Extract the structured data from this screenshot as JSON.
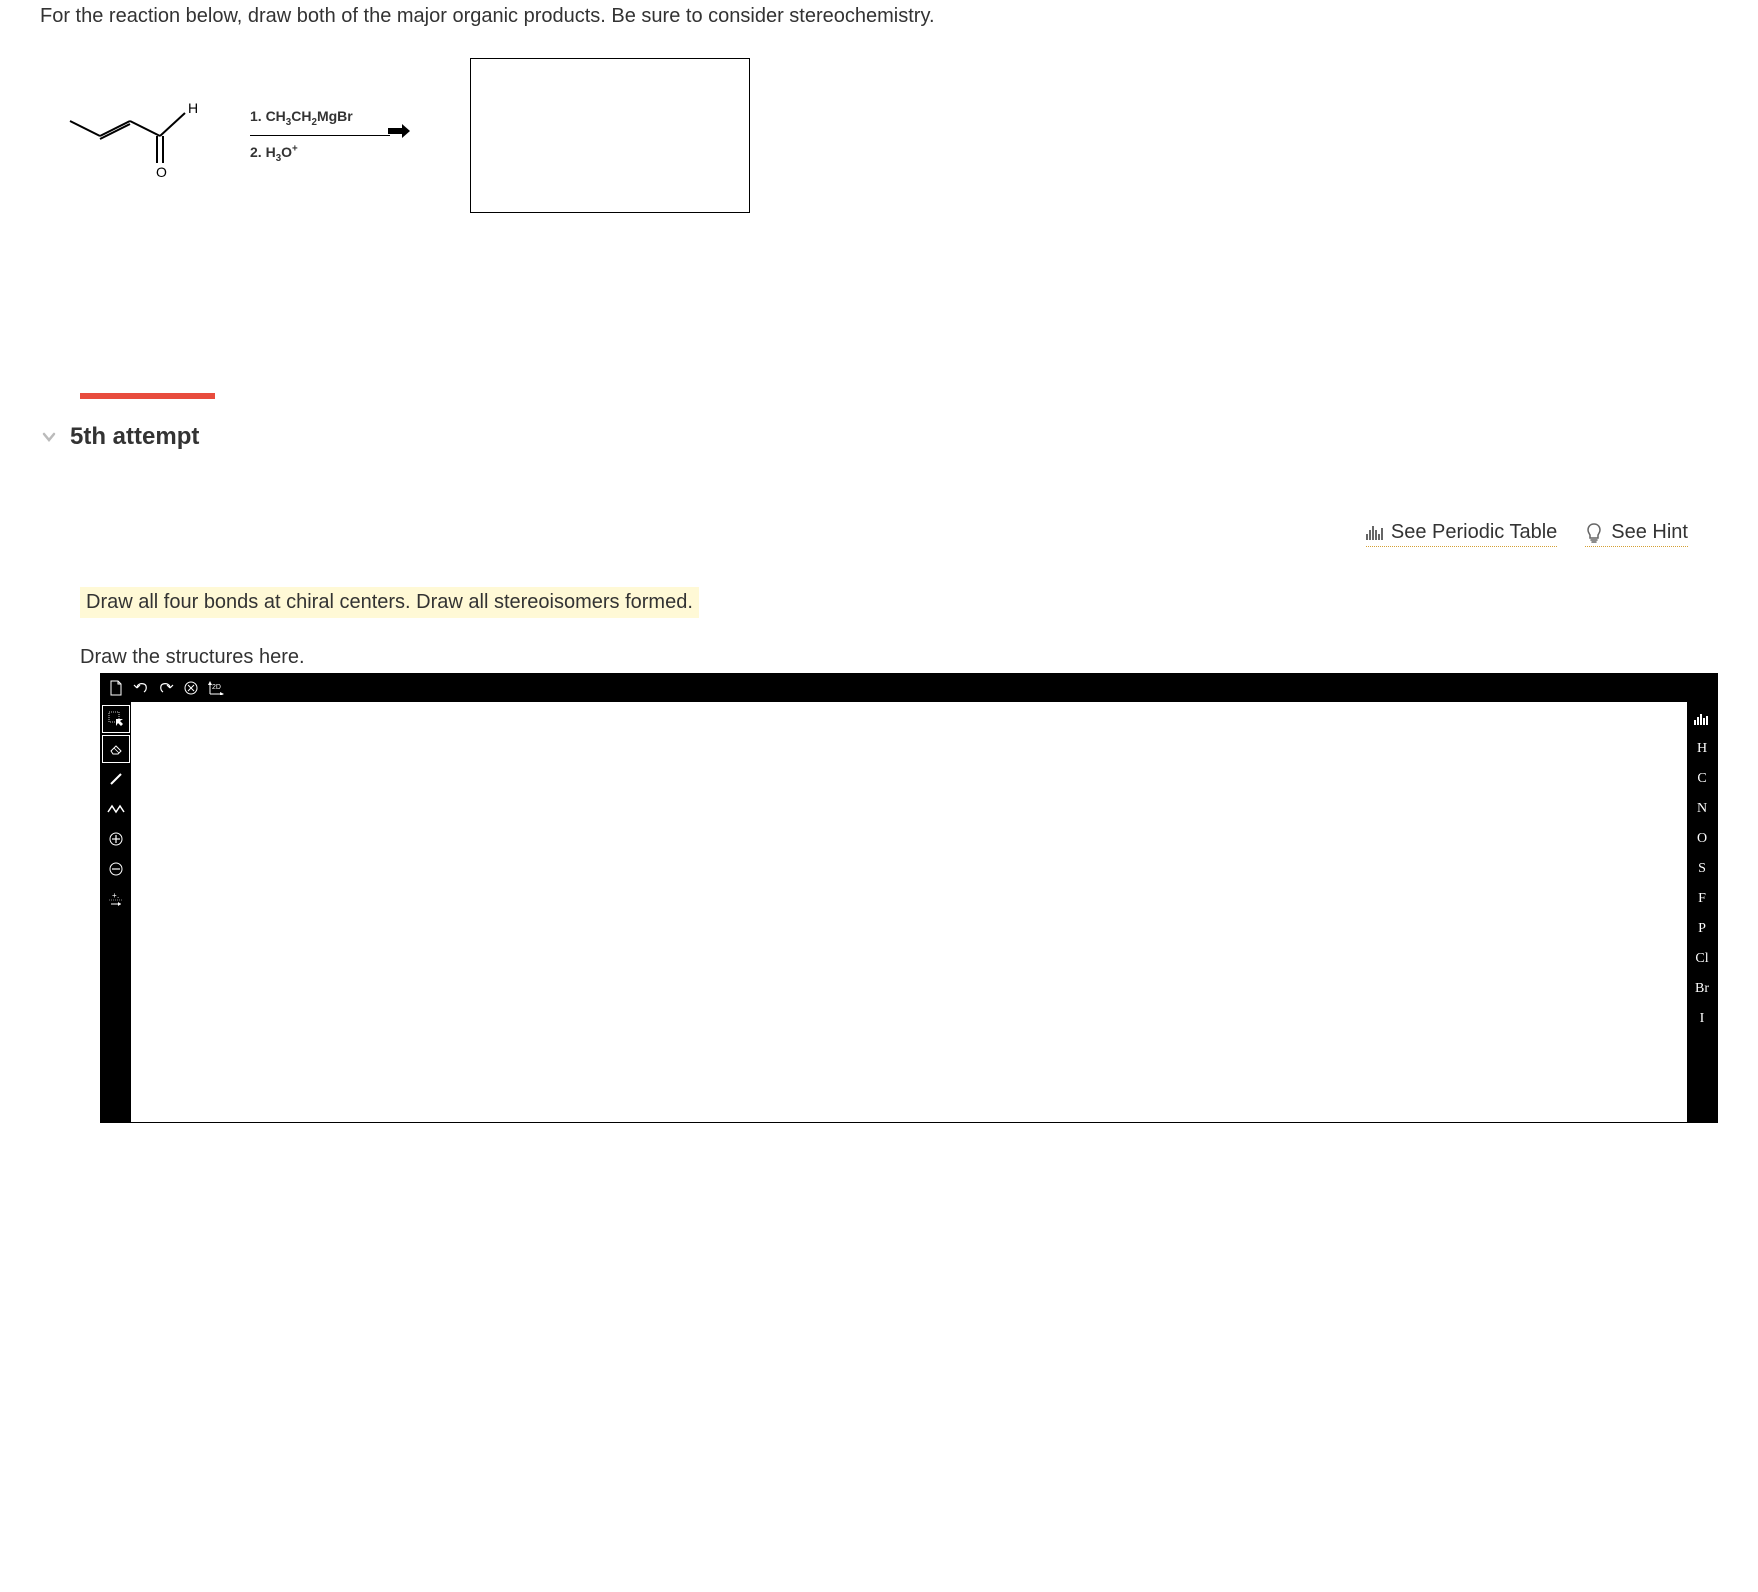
{
  "question": "For the reaction below, draw both of the major organic products. Be sure to consider stereochemistry.",
  "reagents": {
    "step1_prefix": "1. CH",
    "step1_sub1": "3",
    "step1_mid": "CH",
    "step1_sub2": "2",
    "step1_suffix": "MgBr",
    "step2_prefix": "2. H",
    "step2_sub": "3",
    "step2_mid": "O",
    "step2_sup": "+"
  },
  "attempt": {
    "label": "5th attempt"
  },
  "helpers": {
    "periodic": "See Periodic Table",
    "hint": "See Hint"
  },
  "instruction": "Draw all four bonds at chiral centers. Draw all stereoisomers formed.",
  "draw_label": "Draw the structures here.",
  "toolbar": {
    "top": [
      "new",
      "undo",
      "redo",
      "clear",
      "2d"
    ],
    "left_tools": [
      "select",
      "eraser",
      "single-bond",
      "chain",
      "plus-charge",
      "minus-charge",
      "radical"
    ],
    "elements": [
      "H",
      "C",
      "N",
      "O",
      "S",
      "F",
      "P",
      "Cl",
      "Br",
      "I"
    ]
  }
}
